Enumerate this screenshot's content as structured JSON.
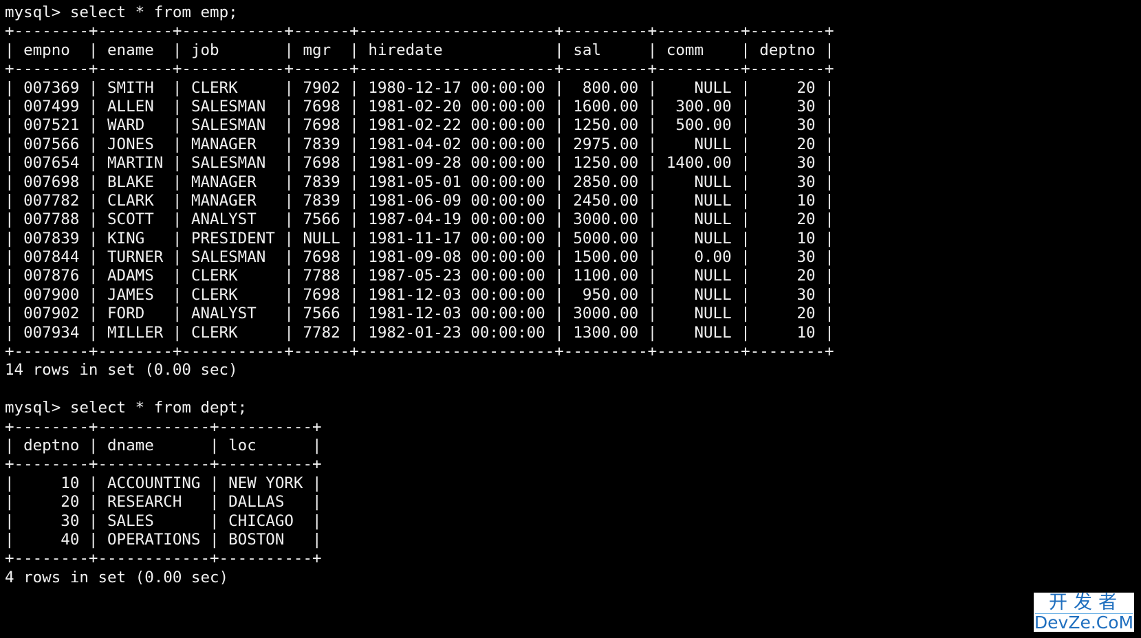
{
  "terminal": {
    "prompt": "mysql> ",
    "queries": [
      {
        "command": "select * from emp;",
        "columns": [
          "empno",
          "ename",
          "job",
          "mgr",
          "hiredate",
          "sal",
          "comm",
          "deptno"
        ],
        "align": [
          "left",
          "left",
          "left",
          "left",
          "left",
          "right",
          "right",
          "right"
        ],
        "rows": [
          [
            "007369",
            "SMITH",
            "CLERK",
            "7902",
            "1980-12-17 00:00:00",
            "800.00",
            "NULL",
            "20"
          ],
          [
            "007499",
            "ALLEN",
            "SALESMAN",
            "7698",
            "1981-02-20 00:00:00",
            "1600.00",
            "300.00",
            "30"
          ],
          [
            "007521",
            "WARD",
            "SALESMAN",
            "7698",
            "1981-02-22 00:00:00",
            "1250.00",
            "500.00",
            "30"
          ],
          [
            "007566",
            "JONES",
            "MANAGER",
            "7839",
            "1981-04-02 00:00:00",
            "2975.00",
            "NULL",
            "20"
          ],
          [
            "007654",
            "MARTIN",
            "SALESMAN",
            "7698",
            "1981-09-28 00:00:00",
            "1250.00",
            "1400.00",
            "30"
          ],
          [
            "007698",
            "BLAKE",
            "MANAGER",
            "7839",
            "1981-05-01 00:00:00",
            "2850.00",
            "NULL",
            "30"
          ],
          [
            "007782",
            "CLARK",
            "MANAGER",
            "7839",
            "1981-06-09 00:00:00",
            "2450.00",
            "NULL",
            "10"
          ],
          [
            "007788",
            "SCOTT",
            "ANALYST",
            "7566",
            "1987-04-19 00:00:00",
            "3000.00",
            "NULL",
            "20"
          ],
          [
            "007839",
            "KING",
            "PRESIDENT",
            "NULL",
            "1981-11-17 00:00:00",
            "5000.00",
            "NULL",
            "10"
          ],
          [
            "007844",
            "TURNER",
            "SALESMAN",
            "7698",
            "1981-09-08 00:00:00",
            "1500.00",
            "0.00",
            "30"
          ],
          [
            "007876",
            "ADAMS",
            "CLERK",
            "7788",
            "1987-05-23 00:00:00",
            "1100.00",
            "NULL",
            "20"
          ],
          [
            "007900",
            "JAMES",
            "CLERK",
            "7698",
            "1981-12-03 00:00:00",
            "950.00",
            "NULL",
            "30"
          ],
          [
            "007902",
            "FORD",
            "ANALYST",
            "7566",
            "1981-12-03 00:00:00",
            "3000.00",
            "NULL",
            "20"
          ],
          [
            "007934",
            "MILLER",
            "CLERK",
            "7782",
            "1982-01-23 00:00:00",
            "1300.00",
            "NULL",
            "10"
          ]
        ],
        "status": "14 rows in set (0.00 sec)"
      },
      {
        "command": "select * from dept;",
        "columns": [
          "deptno",
          "dname",
          "loc"
        ],
        "align": [
          "right",
          "left",
          "left"
        ],
        "rows": [
          [
            "10",
            "ACCOUNTING",
            "NEW YORK"
          ],
          [
            "20",
            "RESEARCH",
            "DALLAS"
          ],
          [
            "30",
            "SALES",
            "CHICAGO"
          ],
          [
            "40",
            "OPERATIONS",
            "BOSTON"
          ]
        ],
        "status": "4 rows in set (0.00 sec)"
      }
    ]
  },
  "watermark": {
    "chinese": "开发者",
    "latin": "DevZe.CoM",
    "color": "#1f6fbf"
  }
}
